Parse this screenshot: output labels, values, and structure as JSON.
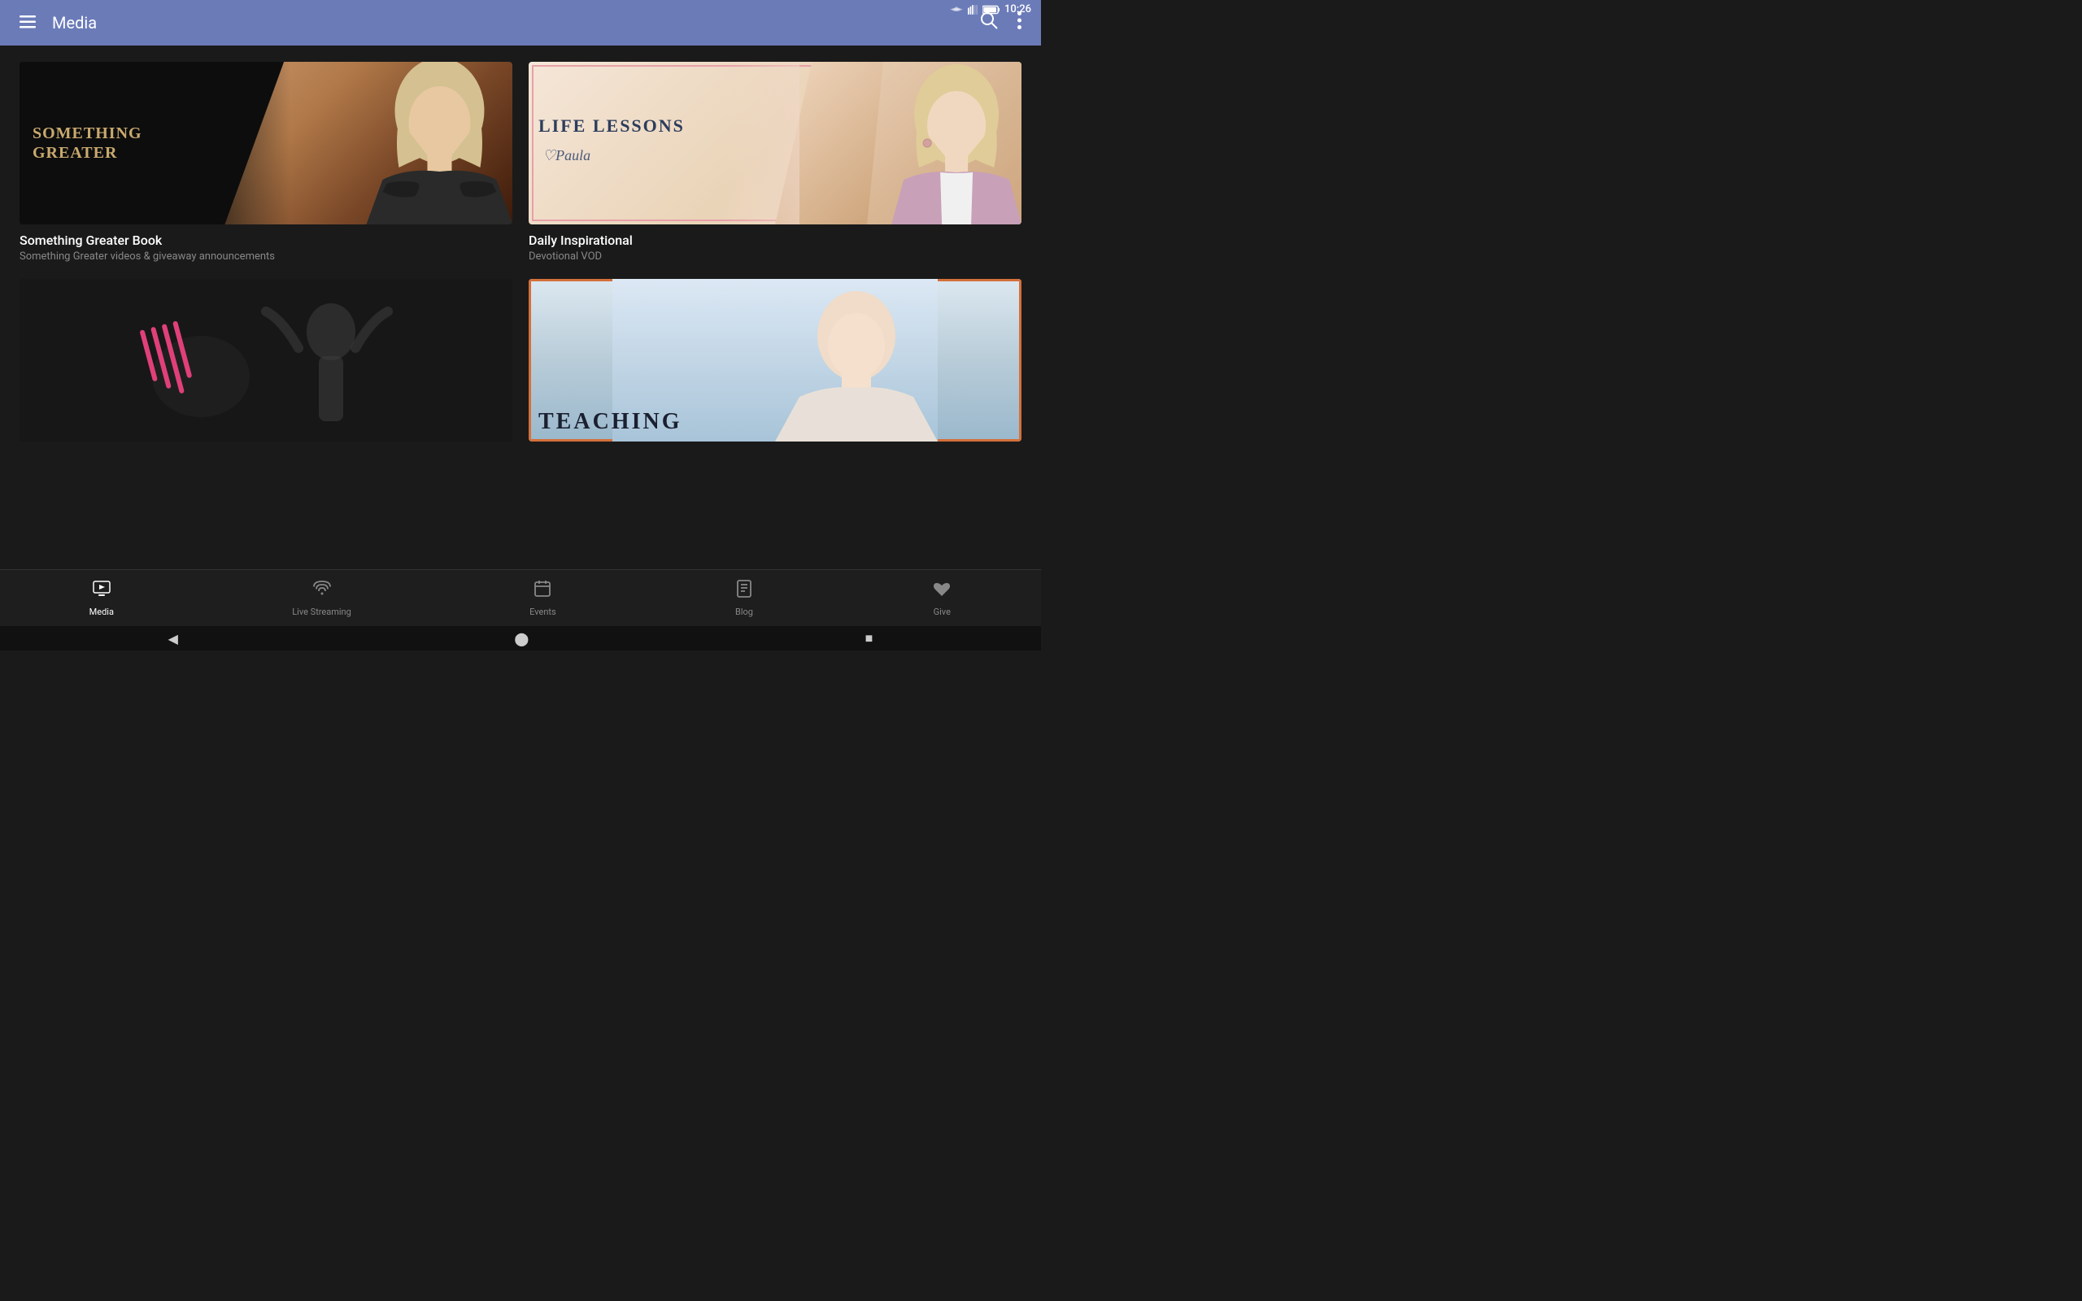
{
  "statusBar": {
    "time": "10:26",
    "icons": [
      "signal",
      "wifi",
      "battery"
    ]
  },
  "topBar": {
    "title": "Media",
    "menuIcon": "≡",
    "searchIcon": "🔍",
    "moreIcon": "⋮"
  },
  "cards": [
    {
      "id": "card1",
      "thumbnailAlt": "Something Greater Book thumbnail",
      "titleLine1": "SOMETHING",
      "titleLine2": "GREATER",
      "title": "Something Greater Book",
      "subtitle": "Something Greater videos & giveaway announcements"
    },
    {
      "id": "card2",
      "thumbnailAlt": "Daily Inspirational thumbnail",
      "mainTitle": "LIFE LESSONS",
      "cursiveText": "♡Paula",
      "title": "Daily Inspirational",
      "subtitle": "Devotional VOD"
    },
    {
      "id": "card3",
      "thumbnailAlt": "Worship thumbnail",
      "title": "",
      "subtitle": ""
    },
    {
      "id": "card4",
      "thumbnailAlt": "Teaching thumbnail",
      "bigText": "TEACHING",
      "title": "",
      "subtitle": ""
    }
  ],
  "bottomNav": {
    "items": [
      {
        "id": "media",
        "label": "Media",
        "icon": "▶",
        "active": true
      },
      {
        "id": "live-streaming",
        "label": "Live Streaming",
        "icon": "📡",
        "active": false
      },
      {
        "id": "events",
        "label": "Events",
        "icon": "📅",
        "active": false
      },
      {
        "id": "blog",
        "label": "Blog",
        "icon": "📖",
        "active": false
      },
      {
        "id": "give",
        "label": "Give",
        "icon": "♥",
        "active": false
      }
    ]
  },
  "systemNav": {
    "backIcon": "◀",
    "homeIcon": "⬤",
    "recentsIcon": "■"
  }
}
